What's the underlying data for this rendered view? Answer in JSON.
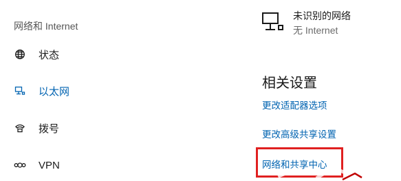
{
  "settings": {
    "section_title": "网络和 Internet",
    "nav": [
      {
        "label": "状态",
        "icon": "globe-icon"
      },
      {
        "label": "以太网",
        "icon": "ethernet-monitor-icon",
        "active": true
      },
      {
        "label": "拨号",
        "icon": "dialup-phone-icon"
      },
      {
        "label": "VPN",
        "icon": "vpn-icon"
      }
    ],
    "network": {
      "name": "未识别的网络",
      "status": "无 Internet",
      "icon": "ethernet-monitor-icon"
    },
    "related": {
      "heading": "相关设置",
      "links": [
        {
          "label": "更改适配器选项"
        },
        {
          "label": "更改高级共享设置"
        },
        {
          "label": "网络和共享中心"
        }
      ]
    }
  },
  "colors": {
    "accent": "#0063b1",
    "highlight_border": "#e02020",
    "muted_text": "#555555"
  }
}
